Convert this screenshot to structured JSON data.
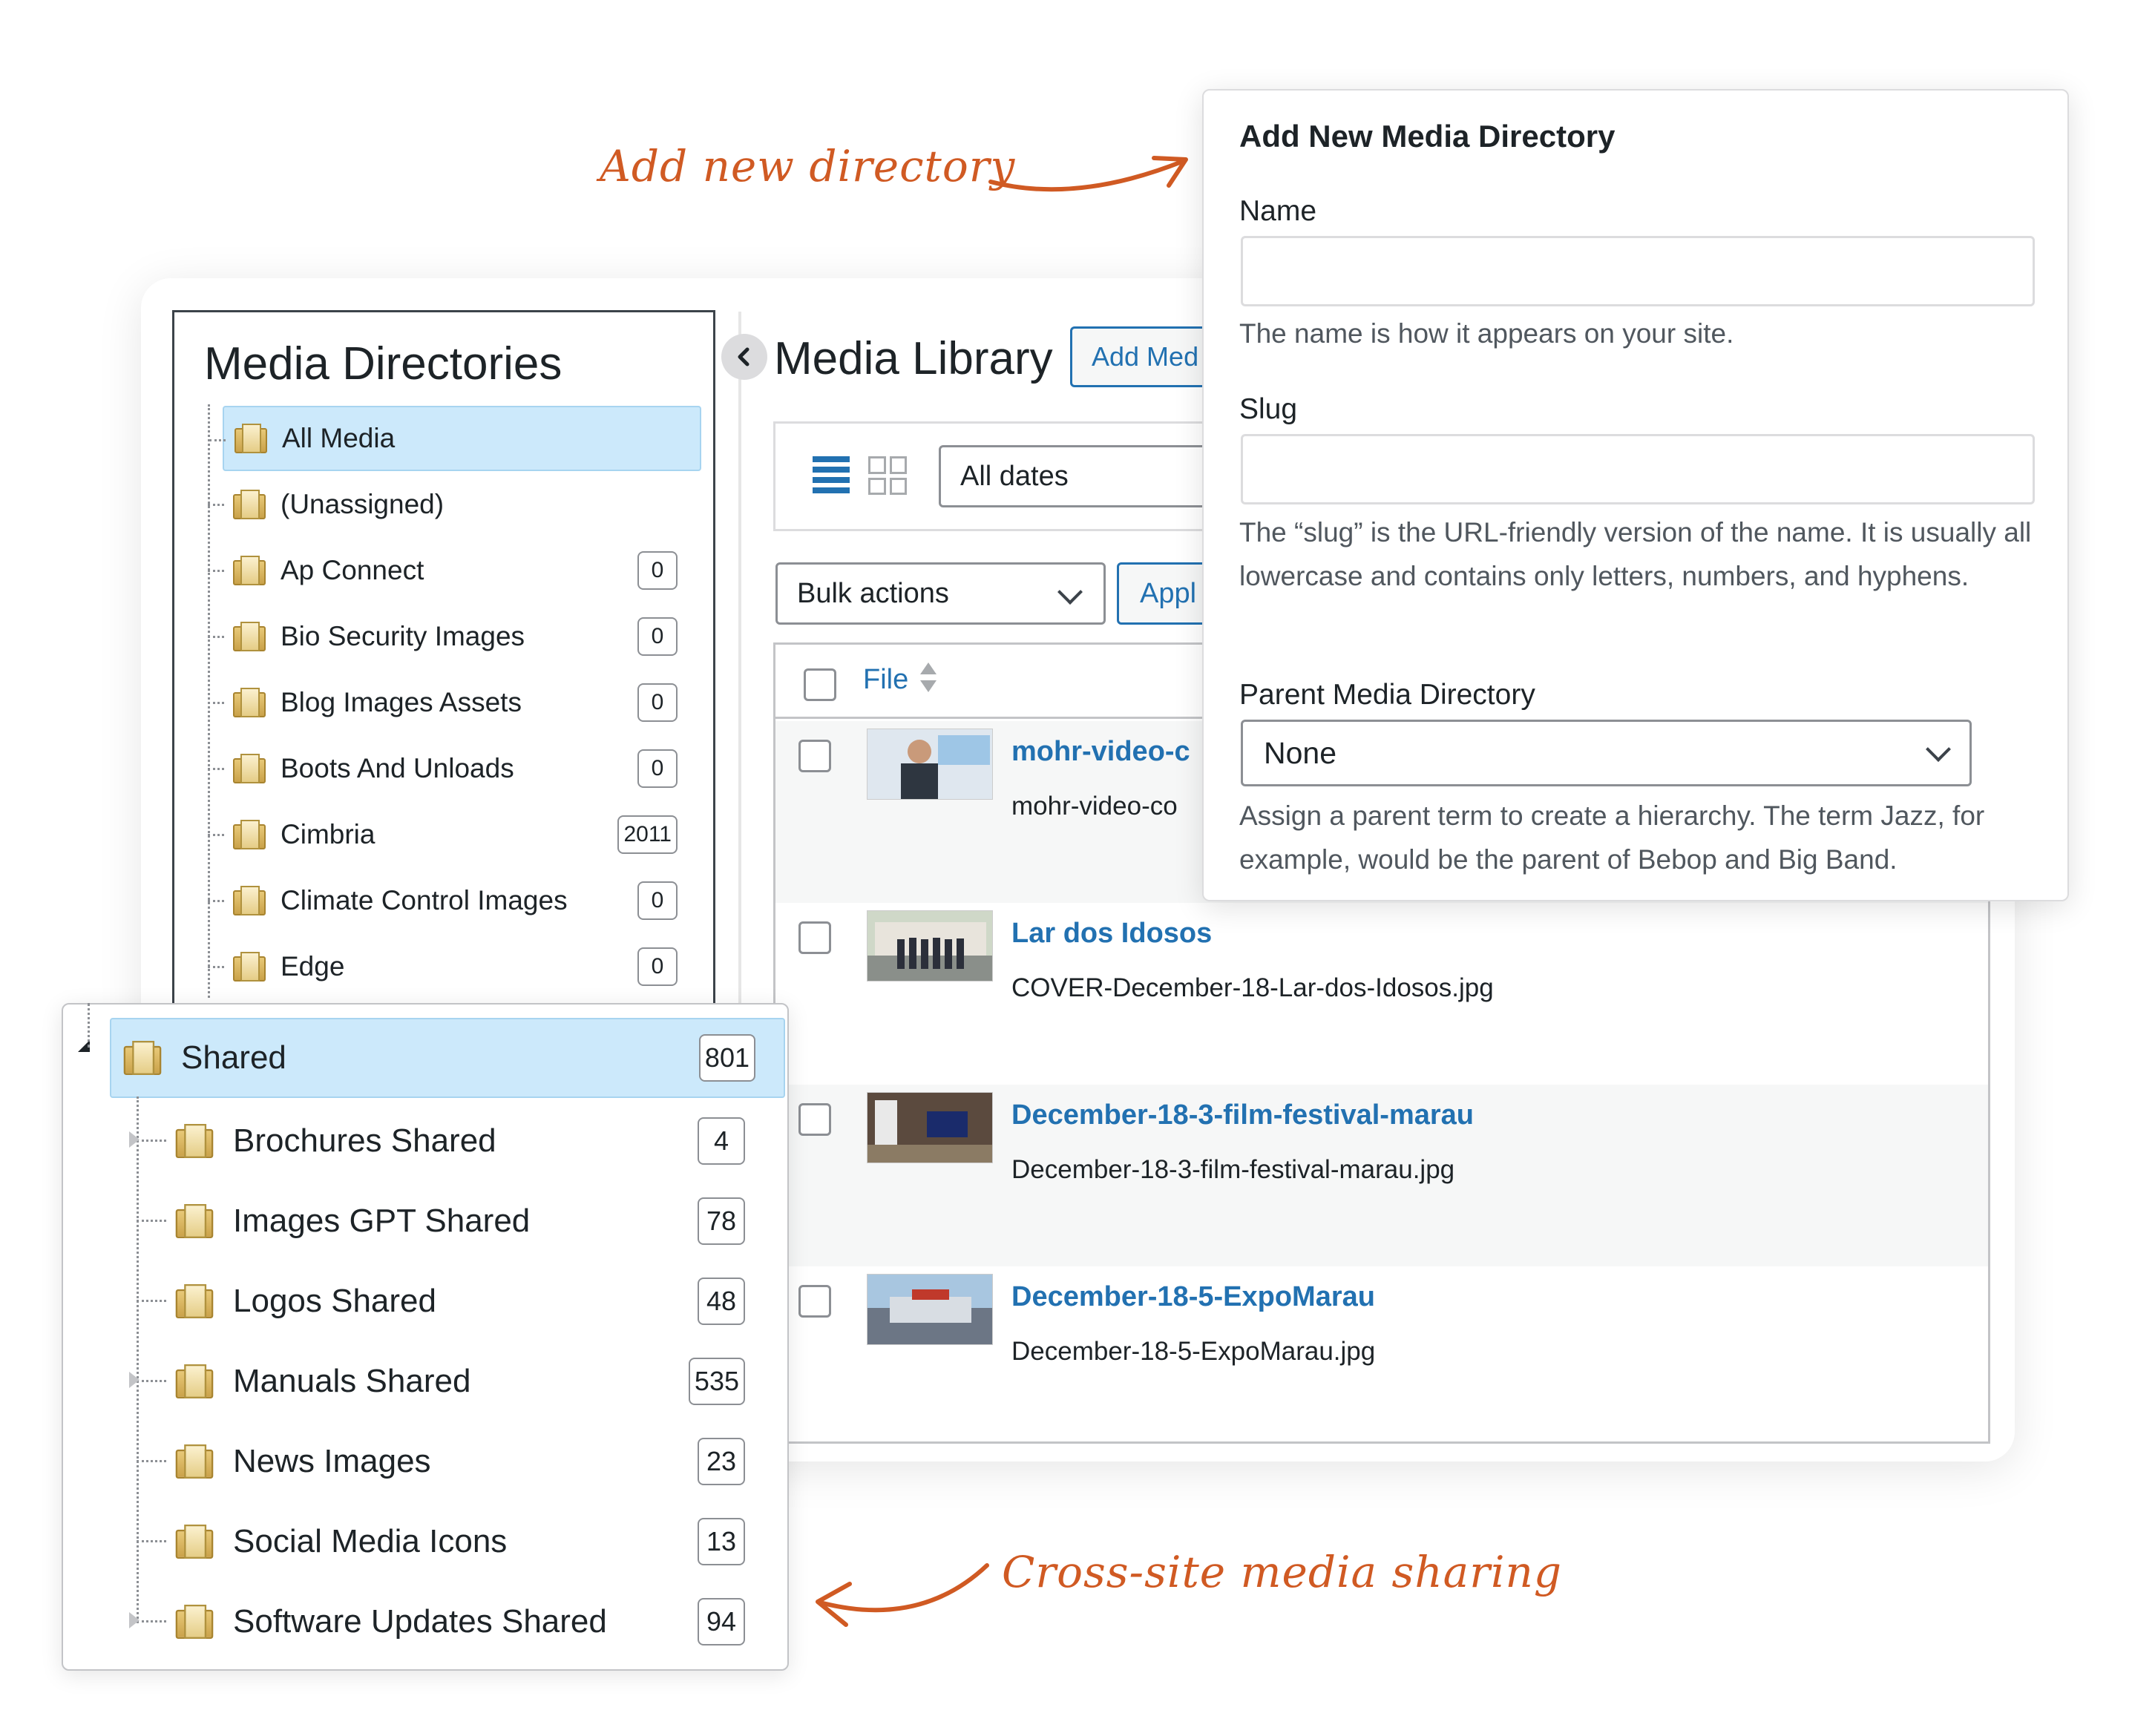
{
  "annotations": {
    "add_new_directory": "Add new directory",
    "cross_site": "Cross-site media sharing"
  },
  "sidebar": {
    "title": "Media Directories",
    "items": [
      {
        "label": "All Media",
        "count": null,
        "selected": true
      },
      {
        "label": "(Unassigned)",
        "count": null
      },
      {
        "label": "Ap Connect",
        "count": "0"
      },
      {
        "label": "Bio Security Images",
        "count": "0"
      },
      {
        "label": "Blog Images Assets",
        "count": "0"
      },
      {
        "label": "Boots And Unloads",
        "count": "0"
      },
      {
        "label": "Cimbria",
        "count": "2011"
      },
      {
        "label": "Climate Control Images",
        "count": "0"
      },
      {
        "label": "Edge",
        "count": "0"
      }
    ]
  },
  "shared": {
    "label": "Shared",
    "count": "801",
    "children": [
      {
        "label": "Brochures Shared",
        "count": "4"
      },
      {
        "label": "Images GPT Shared",
        "count": "78"
      },
      {
        "label": "Logos Shared",
        "count": "48"
      },
      {
        "label": "Manuals Shared",
        "count": "535"
      },
      {
        "label": "News Images",
        "count": "23"
      },
      {
        "label": "Social Media Icons",
        "count": "13"
      },
      {
        "label": "Software Updates Shared",
        "count": "94"
      }
    ]
  },
  "library": {
    "title": "Media Library",
    "add_media": "Add Med",
    "dates_filter": "All dates",
    "bulk_actions": "Bulk actions",
    "apply": "Appl",
    "column_file": "File",
    "rows": [
      {
        "title": "mohr-video-c",
        "file": "mohr-video-co"
      },
      {
        "title": "Lar dos Idosos",
        "file": "COVER-December-18-Lar-dos-Idosos.jpg"
      },
      {
        "title": "December-18-3-film-festival-marau",
        "file": "December-18-3-film-festival-marau.jpg"
      },
      {
        "title": "December-18-5-ExpoMarau",
        "file": "December-18-5-ExpoMarau.jpg"
      }
    ]
  },
  "add_directory": {
    "title": "Add New Media Directory",
    "name_label": "Name",
    "name_value": "",
    "name_help": "The name is how it appears on your site.",
    "slug_label": "Slug",
    "slug_value": "",
    "slug_help": "The “slug” is the URL-friendly version of the name. It is usually all lowercase and contains only letters, numbers, and hyphens.",
    "parent_label": "Parent Media Directory",
    "parent_value": "None",
    "parent_help": "Assign a parent term to create a hierarchy. The term Jazz, for example, would be the parent of Bebop and Big Band."
  },
  "colors": {
    "accent": "#2271b1",
    "selected_bg": "#cce9fb",
    "annotation": "#d05a23"
  }
}
